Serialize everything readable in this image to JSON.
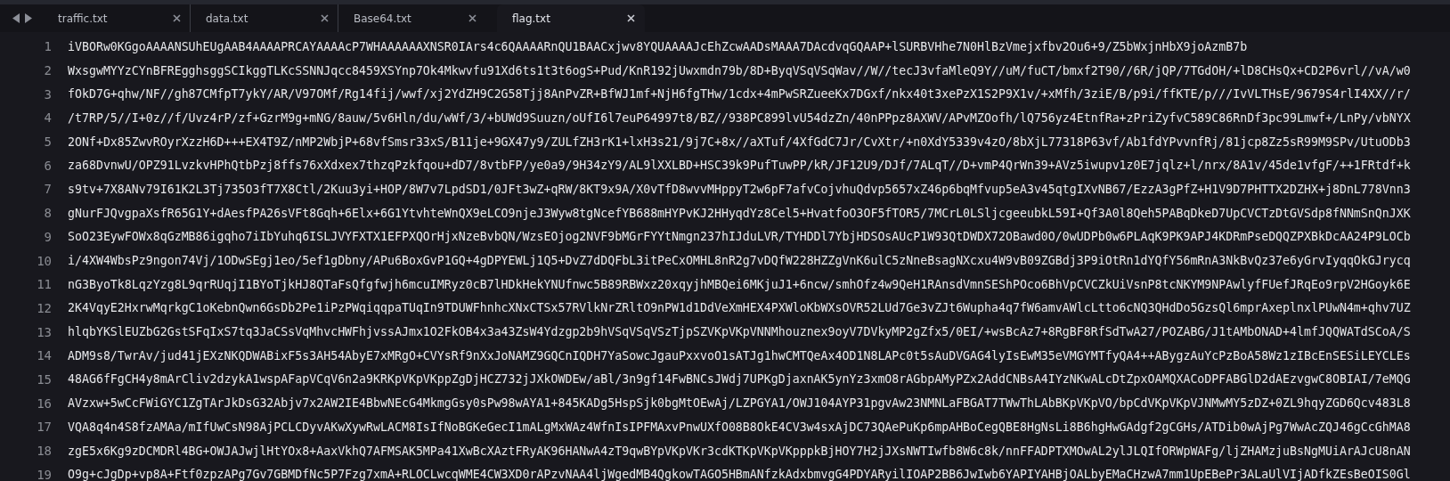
{
  "tabs": [
    {
      "label": "traffic.txt",
      "selected": false
    },
    {
      "label": "data.txt",
      "selected": false
    },
    {
      "label": "Base64.txt",
      "selected": false
    },
    {
      "label": "flag.txt",
      "selected": true
    }
  ],
  "lines": [
    {
      "number": "1",
      "text": "iVBORw0KGgoAAAANSUhEUgAAB4AAAAPRCAYAAAAcP7WHAAAAAAXNSR0IArs4c6QAAAARnQU1BAACxjwv8YQUAAAAJcEhZcwAADsMAAA7DAcdvqGQAAP+lSURBVHhe7N0HlBzVmejxfbv2Ou6+9/Z5bWxjnHbX9joAzmB7b"
    },
    {
      "number": "2",
      "text": "WxsgwMYYzCYnBFREgghsggSCIkggTLKcSSNNJqcc8459XSYnp7Ok4Mkwvfu91Xd6ts1t3t6ogS+Pud/KnR192jUwxmdn79b/8D+ByqVSqVSqWav//W//tecJ3vfaMleQ9Y//uM/fuCT/bmxf2T90//6R/jQP/7TGdOH/+lD8CHsQx+CD2P6vrl//vA/w0"
    },
    {
      "number": "3",
      "text": "fOkD7G+qhw/NF//gh87CMfpT7ykY/AR/V97OMf/Rg14fij/wwf/xj2YdZH9C2G58Tjj8AnPvZR+BfWJ1mf+NjH6fgTHw/1cdx+4mPwSRZueeKx7DGxf/nkx40t3xePzX1S2P9X1v/+xMfh/3ziE/B/p9i/ffKTE/p///IvVLTHsE/9679S4rlI4XX//r/"
    },
    {
      "number": "4",
      "text": "/t7RP/5//I+0z//f/Uvz4rP/zf+GzrM9g+mNG/8auw/5v6Hln/du/wWf/3/+bUWd9Suuzn/oUfI6l7euP64997t8/BZ//938PC899lvU54dzZn/40nPPpz8AXWV/APvMZOofh/lQ756yz4EtnfRa+zPriZyfvC589C86RnDf3pc99Lmwf+/LnPy/vbNYX"
    },
    {
      "number": "5",
      "text": "2ONf+Dx85ZwvROyrXzzH6D+++EX4T9Z/nMP2WbjP+68vfSmsr33xS/B11je+9GX47y9/ZULfZH3rK1+lxH3s21/9j7C+8x//aXTuf/4XfGdC7Jr/CvXtr/+n0XdY5339v4zO/8bXjL77318P63vf/Ab1fdYPvvnfRj/81jcp8Zz5sR99M9SPv/UtuODb3"
    },
    {
      "number": "6",
      "text": "za68DvnwU/OPZ91LvzkvHPhQtbPzj8ffs76xXdxex7thzqPzkfqou+dD7/8vtbFP/ye0a9/9H34zY9/AL9lXXLBD+HSC39k9PufTuwPP/kR/JF12U9/DJf/7ALqT//D+vmP4QrWn39+AVz5iwupv1z0E7jqlz+l/nrx/8A1v/45de1vfgF/++1FRtdf+k"
    },
    {
      "number": "7",
      "text": "s9tv+7X8ANv79I61K2L3Tj735O3fT7X8Ctl/2Kuu3yi+HOP/8W7v7LpdSD1/0JFt3wZ+qRW/8KT9x9A/X0vTfD8wvvMHppyT2w6pF7afvCojvhuQdvp5657xZ46p6bqMfvup5eA3v45qtgIXvNB67/EzzA3gPfZ+H1V9D7PHTTX2DZHX+j8DnL778Vnn3"
    },
    {
      "number": "8",
      "text": "gNurFJQvgpaXsfR65G1Y+dAesfPA26sVFt8Gqh+6Elx+6G1YtvhteWnQX9eLCO9njeJ3Wyw8tgNcefYB688mHYPvKJ2HHyqdYz8Cel5+HvatfoO3OF5fTOR5/7MCrL0LSljcgeeubkL59I+Qf3A0l8Qeh5PABqDkeD7UpCVCTzDtGVSdp8fNNmSnQnJXK"
    },
    {
      "number": "9",
      "text": "SoO23EywFOWx8qGzMB86igqho7iIbYuhq6ISLJVYFXTX1EFPXQOrHjxNzeBvbQN/WzsEOjog2NVF9bMGrFYYtNmgn237hIJduLVR/TYHDDl7YbjHDSOsAUcP1W93QtDWDX72OBawd0O/0wUDPb0w6PLAqK9PK9APJ4KDRmPseDQQZPXBkDcAA24P9LOCb"
    },
    {
      "number": "10",
      "text": "i/4XW4WbsPz9ngon74Vj/1ODwSEgj1eo/5ef1gDbny/APu6BoxGvP1GQ+4gDPYEWLj1Q5+DvZ7dDQFbL3itPeCxOMHL8nR2g7vDQfW228HZZgVnK6ulC5zNneBsagNXcxu4W9vB09ZGBdj3P9iOtRn1dYQfY56mRnA3NkBvQz37e6yGrvIyqqOkGJrycq"
    },
    {
      "number": "11",
      "text": "nG3ByoTk8LqzYzg8L9qrRUqjI1BYoTjkHJ8QTaFsQfgfwjh6mcuIMRyz0cB7lHDkHekYNUfnwc5B89RBWxz20xqyjhMBQei6MKjuJ1+6ncw/smhOfz4w9QeH1RAnsdVmnSEShPOco6BhVpCVCZkUiVsnP8tcNKYM9NPAwlyfFUefJRqEo9rpV2HGoyk6E"
    },
    {
      "number": "12",
      "text": "2K4VqyE2HxrwMqrkgC1oKebnQwn6GsDb2Pe1iPzPWqiqqpaTUqIn9TDUWFhnhcXNxCTSx57RVlkNrZRltO9nPW1d1DdVeXmHEX4PXWloKbWXsOVR52LUd7Ge3vZJt6Wupha4q7fW6amvAWlcLtto6cNQ3QHdDo5GzsQl6mprAxeplnxlPUwN4m+qhv7UZ"
    },
    {
      "number": "13",
      "text": "hlqbYKSlEUZbG2GstSFqIxS7tq3JaCSsVqMhvcHWFhjvssAJmx1O2FkOB4x3a43ZsW4Ydzgp2b9hVSqVSqVSzTjpSZVKpVKpVNNMhouznex9oyV7DVkyMP2gZfx5/0EI/+wsBcAz7+8RgBF8RfSdTwA27/POZABG/J1tAMbONAD+4lmfJQQWATdSCoA/S"
    },
    {
      "number": "14",
      "text": "ADM9s8/TwrAv/jud41jEXzNKQDWABixF5s3AH54AbyE7xMRgO+CVYsRf9nXxJoNAMZ9GQCnIQDH7YaSowcJgauPxxvoO1sATJg1hwCMTQeAx4OD1N8LAPc0t5sAuDVGAG4lyIsEwM35eVMGYMTfyQA4++ABygzAuYcPzBoA58Wz1zIBcEnSESiLEYCLEs"
    },
    {
      "number": "15",
      "text": "48AG6fFgCH4y8mArCliv2dzykA1wspAFapVCqV6n2a9KRKpVKpVKppZgDjHCZ732jJXkOWDEw/aBl/3n9gf14FwBNCsJWdj7UPKgDjaxnAK5ynYz3xmO8rAGbpAMyPZx2AddCNBsA4IYzNKwALcDtZpxOAMQXACoDPFABGlD2dAEzvgwC8OBIAI/7eMQG"
    },
    {
      "number": "16",
      "text": "AVzxw+5wCcFWiGYC1ZgTArJkDsG32Abjv7x2AW2IE4BbwNEcG4MkmgGsy0sPw98wAYA1+845KADg5HspSjk0bgMtOEwAj/LZPGYA1/OWJ104AYP31pgvAw23NMNLaFBGAT7TWwThLAbBKpVKpVO/bpCdVKpVKpVJNMwMY5zDZ+0ZL9hqyZGD6Qcv483L8"
    },
    {
      "number": "17",
      "text": "VQA8q4n4S8fzAMAa/mIfUwCsN98AjPCLCDyvAKwXywRwLACM8IsIfNoBGKeGecI1mALgMxWAz4WfnIsIPFMAxvPnwUXfO08B8OkE4CV3w4sxAjDC73QAePuKp6mpAHBoCegQBE8HgNsLi8B6hgHwGAdgf2gCGHs/ATDib0wAjPg7WwAcZQJ46gCcGhMA8"
    },
    {
      "number": "18",
      "text": "zgE5x6Kg9zDCMDRl4BG+OWJAJwjlHtYOx8+AaxVkhQ7AFMSAK5MPa41XwBcXAztFRyAK96HANwA4zT9qwBYpVKpVKr3cdKTKpVKpVKpppkBjHOY7H2jJXsNWTIwfb8W6c8k/nnFFADPTXMOwAL2ylJLQIfORWpWAFg/ljZHAMzjuBsNgMUiArAJcU8nAN"
    },
    {
      "number": "19",
      "text": "O9g+cJgDp+vp8A+Ftf0zpzAPg7Gv7GBMDfNc5P7Fzg7xmA+RLOCLwcqWME4CW3XD0rAPzvNAA4ljWgedMB4QgkowTAGO5HBmANfzkAdxbmvgG4PDYARyilIOAP2BB6JwIwb6YAPIYAHBjOALbyEMaCHzwA7mm1UpEBePr3ALaUlVIjADfkZEsBeOIS0Gl"
    }
  ]
}
